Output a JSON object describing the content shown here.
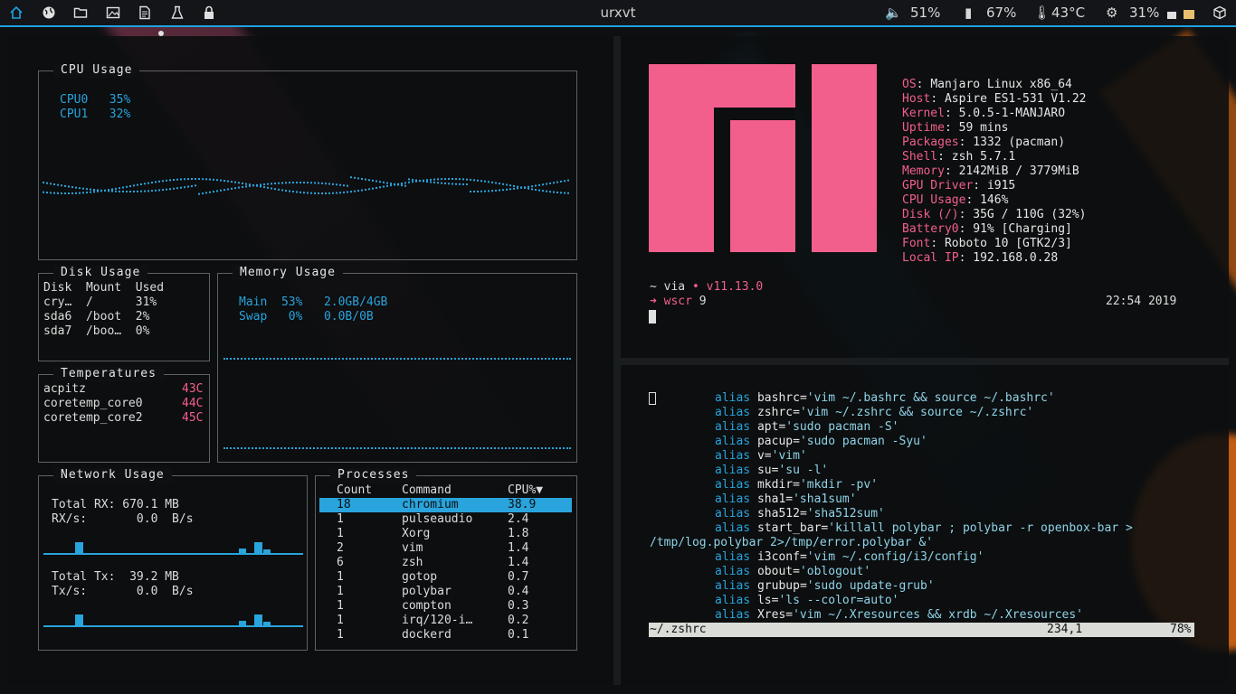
{
  "topbar": {
    "title": "urxvt",
    "volume": "51%",
    "battery": "67%",
    "temperature": "43°C",
    "cpu": "31%",
    "workspace_icons": [
      "home-icon",
      "globe-icon",
      "folder-icon",
      "image-icon",
      "document-icon",
      "flask-icon",
      "lock-icon"
    ]
  },
  "cpu": {
    "label": "CPU Usage",
    "cores": [
      {
        "name": "CPU0",
        "value": "35%"
      },
      {
        "name": "CPU1",
        "value": "32%"
      }
    ]
  },
  "disk": {
    "label": "Disk Usage",
    "headers": [
      "Disk",
      "Mount",
      "Used"
    ],
    "rows": [
      [
        "cry…",
        "/",
        "31%"
      ],
      [
        "sda6",
        "/boot",
        "2%"
      ],
      [
        "sda7",
        "/boo…",
        "0%"
      ]
    ]
  },
  "temps": {
    "label": "Temperatures",
    "rows": [
      {
        "name": "acpitz",
        "value": "43C"
      },
      {
        "name": "coretemp_core0",
        "value": "44C"
      },
      {
        "name": "coretemp_core2",
        "value": "45C"
      }
    ]
  },
  "memory": {
    "label": "Memory Usage",
    "main": {
      "name": "Main",
      "pct": "53%",
      "amount": "2.0GB/4GB"
    },
    "swap": {
      "name": "Swap",
      "pct": "0%",
      "amount": "0.0B/0B"
    }
  },
  "network": {
    "label": "Network Usage",
    "rx_total": "Total RX: 670.1 MB",
    "rx_rate": "RX/s:       0.0  B/s",
    "tx_total": "Total Tx:  39.2 MB",
    "tx_rate": "Tx/s:       0.0  B/s"
  },
  "processes": {
    "label": "Processes",
    "headers": [
      "Count",
      "Command",
      "CPU%▼"
    ],
    "rows": [
      [
        "18",
        "chromium",
        "38.9"
      ],
      [
        "1",
        "pulseaudio",
        "2.4"
      ],
      [
        "1",
        "Xorg",
        "1.8"
      ],
      [
        "2",
        "vim",
        "1.4"
      ],
      [
        "6",
        "zsh",
        "1.4"
      ],
      [
        "1",
        "gotop",
        "0.7"
      ],
      [
        "1",
        "polybar",
        "0.4"
      ],
      [
        "1",
        "compton",
        "0.3"
      ],
      [
        "1",
        "irq/120-i…",
        "0.2"
      ],
      [
        "1",
        "dockerd",
        "0.1"
      ]
    ]
  },
  "neofetch": {
    "info": [
      {
        "key": "OS",
        "value": "Manjaro Linux x86_64"
      },
      {
        "key": "Host",
        "value": "Aspire ES1-531 V1.22"
      },
      {
        "key": "Kernel",
        "value": "5.0.5-1-MANJARO"
      },
      {
        "key": "Uptime",
        "value": "59 mins"
      },
      {
        "key": "Packages",
        "value": "1332 (pacman)"
      },
      {
        "key": "Shell",
        "value": "zsh 5.7.1"
      },
      {
        "key": "Memory",
        "value": "2142MiB / 3779MiB"
      },
      {
        "key": "GPU Driver",
        "value": "i915"
      },
      {
        "key": "CPU Usage",
        "value": "146%"
      },
      {
        "key": "Disk (/)",
        "value": "35G / 110G (32%)"
      },
      {
        "key": "Battery0",
        "value": "91% [Charging]"
      },
      {
        "key": "Font",
        "value": "Roboto 10 [GTK2/3]"
      },
      {
        "key": "Local IP",
        "value": "192.168.0.28"
      }
    ],
    "prompt_dir": "~",
    "prompt_via": "via",
    "prompt_version": "• v11.13.0",
    "prompt_arrow": "➜",
    "prompt_cmd": "wscr",
    "prompt_arg": "9",
    "clock": "22:54 2019"
  },
  "vim": {
    "lines": [
      {
        "kw": "alias",
        "name": "bashrc",
        "val": "'vim ~/.bashrc && source ~/.bashrc'"
      },
      {
        "kw": "alias",
        "name": "zshrc",
        "val": "'vim ~/.zshrc && source ~/.zshrc'"
      },
      {
        "kw": "alias",
        "name": "apt",
        "val": "'sudo pacman -S'"
      },
      {
        "kw": "alias",
        "name": "pacup",
        "val": "'sudo pacman -Syu'"
      },
      {
        "kw": "alias",
        "name": "v",
        "val": "'vim'"
      },
      {
        "kw": "alias",
        "name": "su",
        "val": "'su -l'"
      },
      {
        "kw": "alias",
        "name": "mkdir",
        "val": "'mkdir -pv'"
      },
      {
        "kw": "alias",
        "name": "sha1",
        "val": "'sha1sum'"
      },
      {
        "kw": "alias",
        "name": "sha512",
        "val": "'sha512sum'"
      },
      {
        "kw": "alias",
        "name": "start_bar",
        "val": "'killall polybar ; polybar -r openbox-bar >"
      },
      {
        "kw": "",
        "name": "",
        "val": "/tmp/log.polybar 2>/tmp/error.polybar &'"
      },
      {
        "kw": "alias",
        "name": "i3conf",
        "val": "'vim ~/.config/i3/config'"
      },
      {
        "kw": "alias",
        "name": "obout",
        "val": "'oblogout'"
      },
      {
        "kw": "alias",
        "name": "grubup",
        "val": "'sudo update-grub'"
      },
      {
        "kw": "alias",
        "name": "ls",
        "val": "'ls --color=auto'"
      },
      {
        "kw": "alias",
        "name": "Xres",
        "val": "'vim ~/.Xresources && xrdb ~/.Xresources'"
      }
    ],
    "status_file": "~/.zshrc",
    "status_pos": "234,1",
    "status_pct": "78%"
  }
}
